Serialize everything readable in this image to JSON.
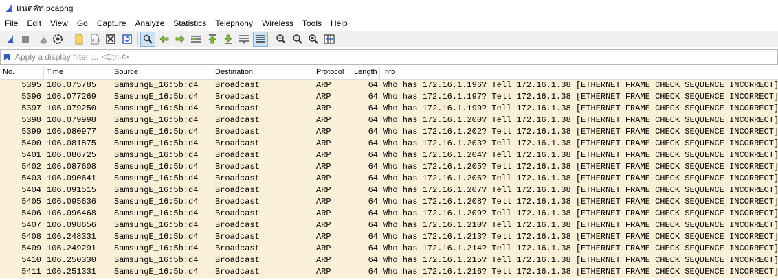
{
  "window": {
    "title": "แนตคัท.pcapng"
  },
  "menu": [
    "File",
    "Edit",
    "View",
    "Go",
    "Capture",
    "Analyze",
    "Statistics",
    "Telephony",
    "Wireless",
    "Tools",
    "Help"
  ],
  "filter": {
    "placeholder": "Apply a display filter … <Ctrl-/>",
    "value": ""
  },
  "columns": {
    "no": "No.",
    "time": "Time",
    "source": "Source",
    "destination": "Destination",
    "protocol": "Protocol",
    "length": "Length",
    "info": "Info"
  },
  "colors": {
    "row_bg": "#faf0d7",
    "accent": "#2f5fb8"
  },
  "packets": [
    {
      "no": "5395",
      "time": "106.075785",
      "src": "SamsungE_16:5b:d4",
      "dst": "Broadcast",
      "proto": "ARP",
      "len": "64",
      "info": "Who has 172.16.1.196? Tell 172.16.1.38 [ETHERNET FRAME CHECK SEQUENCE INCORRECT]"
    },
    {
      "no": "5396",
      "time": "106.077269",
      "src": "SamsungE_16:5b:d4",
      "dst": "Broadcast",
      "proto": "ARP",
      "len": "64",
      "info": "Who has 172.16.1.197? Tell 172.16.1.38 [ETHERNET FRAME CHECK SEQUENCE INCORRECT]"
    },
    {
      "no": "5397",
      "time": "106.079250",
      "src": "SamsungE_16:5b:d4",
      "dst": "Broadcast",
      "proto": "ARP",
      "len": "64",
      "info": "Who has 172.16.1.199? Tell 172.16.1.38 [ETHERNET FRAME CHECK SEQUENCE INCORRECT]"
    },
    {
      "no": "5398",
      "time": "106.079998",
      "src": "SamsungE_16:5b:d4",
      "dst": "Broadcast",
      "proto": "ARP",
      "len": "64",
      "info": "Who has 172.16.1.200? Tell 172.16.1.38 [ETHERNET FRAME CHECK SEQUENCE INCORRECT]"
    },
    {
      "no": "5399",
      "time": "106.080977",
      "src": "SamsungE_16:5b:d4",
      "dst": "Broadcast",
      "proto": "ARP",
      "len": "64",
      "info": "Who has 172.16.1.202? Tell 172.16.1.38 [ETHERNET FRAME CHECK SEQUENCE INCORRECT]"
    },
    {
      "no": "5400",
      "time": "106.081875",
      "src": "SamsungE_16:5b:d4",
      "dst": "Broadcast",
      "proto": "ARP",
      "len": "64",
      "info": "Who has 172.16.1.203? Tell 172.16.1.38 [ETHERNET FRAME CHECK SEQUENCE INCORRECT]"
    },
    {
      "no": "5401",
      "time": "106.086725",
      "src": "SamsungE_16:5b:d4",
      "dst": "Broadcast",
      "proto": "ARP",
      "len": "64",
      "info": "Who has 172.16.1.204? Tell 172.16.1.38 [ETHERNET FRAME CHECK SEQUENCE INCORRECT]"
    },
    {
      "no": "5402",
      "time": "106.087608",
      "src": "SamsungE_16:5b:d4",
      "dst": "Broadcast",
      "proto": "ARP",
      "len": "64",
      "info": "Who has 172.16.1.205? Tell 172.16.1.38 [ETHERNET FRAME CHECK SEQUENCE INCORRECT]"
    },
    {
      "no": "5403",
      "time": "106.090641",
      "src": "SamsungE_16:5b:d4",
      "dst": "Broadcast",
      "proto": "ARP",
      "len": "64",
      "info": "Who has 172.16.1.206? Tell 172.16.1.38 [ETHERNET FRAME CHECK SEQUENCE INCORRECT]"
    },
    {
      "no": "5404",
      "time": "106.091515",
      "src": "SamsungE_16:5b:d4",
      "dst": "Broadcast",
      "proto": "ARP",
      "len": "64",
      "info": "Who has 172.16.1.207? Tell 172.16.1.38 [ETHERNET FRAME CHECK SEQUENCE INCORRECT]"
    },
    {
      "no": "5405",
      "time": "106.095636",
      "src": "SamsungE_16:5b:d4",
      "dst": "Broadcast",
      "proto": "ARP",
      "len": "64",
      "info": "Who has 172.16.1.208? Tell 172.16.1.38 [ETHERNET FRAME CHECK SEQUENCE INCORRECT]"
    },
    {
      "no": "5406",
      "time": "106.096468",
      "src": "SamsungE_16:5b:d4",
      "dst": "Broadcast",
      "proto": "ARP",
      "len": "64",
      "info": "Who has 172.16.1.209? Tell 172.16.1.38 [ETHERNET FRAME CHECK SEQUENCE INCORRECT]"
    },
    {
      "no": "5407",
      "time": "106.098656",
      "src": "SamsungE_16:5b:d4",
      "dst": "Broadcast",
      "proto": "ARP",
      "len": "64",
      "info": "Who has 172.16.1.210? Tell 172.16.1.38 [ETHERNET FRAME CHECK SEQUENCE INCORRECT]"
    },
    {
      "no": "5408",
      "time": "106.248331",
      "src": "SamsungE_16:5b:d4",
      "dst": "Broadcast",
      "proto": "ARP",
      "len": "64",
      "info": "Who has 172.16.1.213? Tell 172.16.1.38 [ETHERNET FRAME CHECK SEQUENCE INCORRECT]"
    },
    {
      "no": "5409",
      "time": "106.249291",
      "src": "SamsungE_16:5b:d4",
      "dst": "Broadcast",
      "proto": "ARP",
      "len": "64",
      "info": "Who has 172.16.1.214? Tell 172.16.1.38 [ETHERNET FRAME CHECK SEQUENCE INCORRECT]"
    },
    {
      "no": "5410",
      "time": "106.250330",
      "src": "SamsungE_16:5b:d4",
      "dst": "Broadcast",
      "proto": "ARP",
      "len": "64",
      "info": "Who has 172.16.1.215? Tell 172.16.1.38 [ETHERNET FRAME CHECK SEQUENCE INCORRECT]"
    },
    {
      "no": "5411",
      "time": "106.251331",
      "src": "SamsungE_16:5b:d4",
      "dst": "Broadcast",
      "proto": "ARP",
      "len": "64",
      "info": "Who has 172.16.1.216? Tell 172.16.1.38 [ETHERNET FRAME CHECK SEQUENCE INCORRECT]"
    }
  ]
}
